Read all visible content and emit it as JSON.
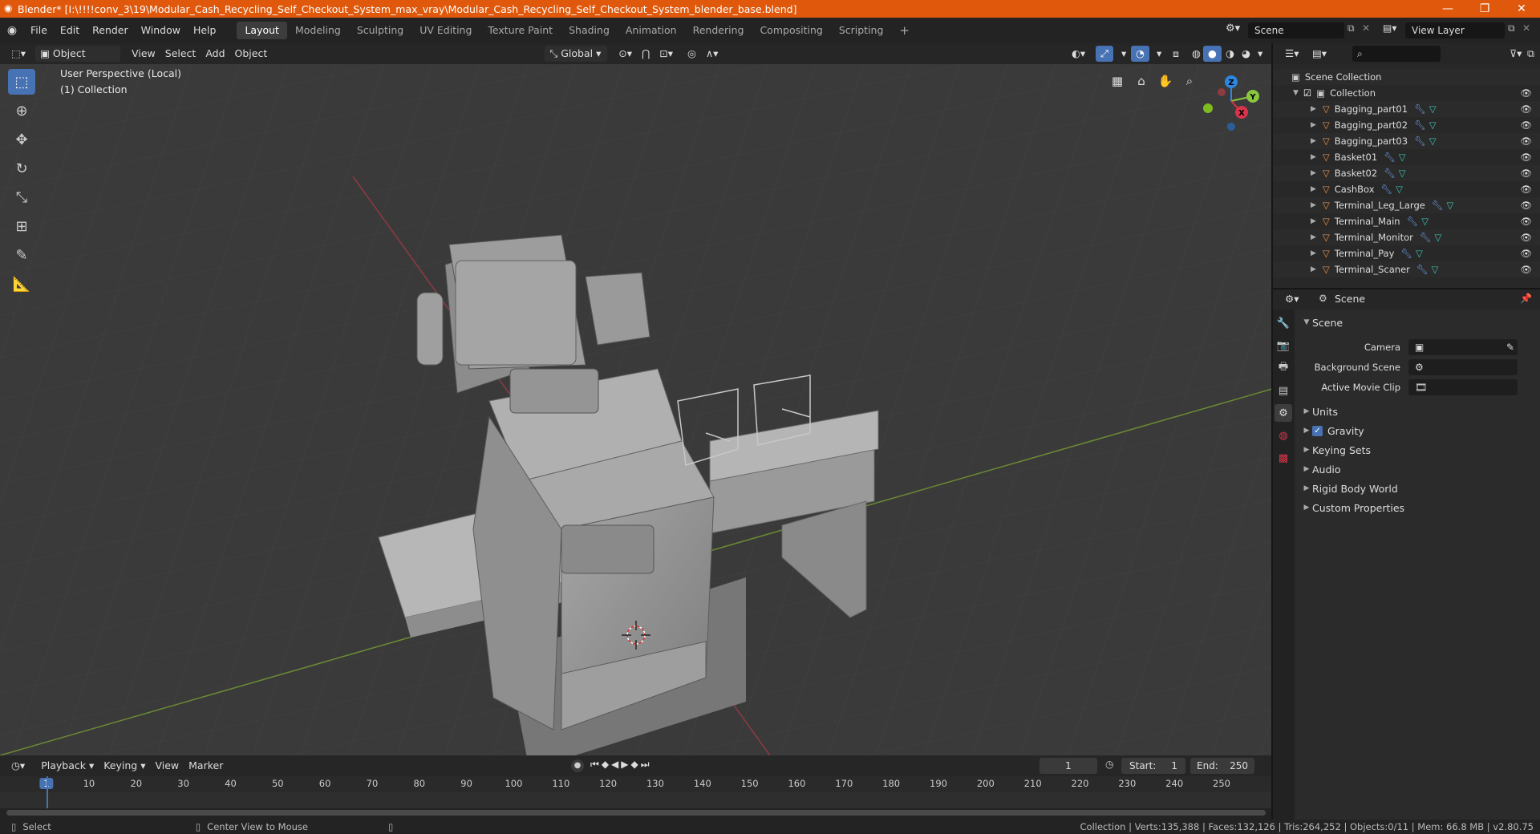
{
  "titlebar": {
    "title": "Blender* [I:\\!!!!conv_3\\19\\Modular_Cash_Recycling_Self_Checkout_System_max_vray\\Modular_Cash_Recycling_Self_Checkout_System_blender_base.blend]",
    "minimize": "—",
    "maximize": "❐",
    "close": "✕",
    "bg_color": "#e0580b"
  },
  "menubar": {
    "items": [
      "File",
      "Edit",
      "Render",
      "Window",
      "Help"
    ]
  },
  "workspaces": {
    "tabs": [
      "Layout",
      "Modeling",
      "Sculpting",
      "UV Editing",
      "Texture Paint",
      "Shading",
      "Animation",
      "Rendering",
      "Compositing",
      "Scripting"
    ],
    "active": "Layout",
    "add": "+"
  },
  "scene_selector": {
    "value": "Scene"
  },
  "view_layer_selector": {
    "value": "View Layer"
  },
  "viewport_header": {
    "mode": "Object Mode",
    "menus": [
      "View",
      "Select",
      "Add",
      "Object"
    ],
    "orientation": "Global"
  },
  "viewport": {
    "perspective_label": "User Perspective (Local)",
    "collection_label": "(1) Collection",
    "gizmo": {
      "z": "Z",
      "y": "Y",
      "x": "X"
    }
  },
  "outliner": {
    "root": "Scene Collection",
    "collection": "Collection",
    "objects": [
      "Bagging_part01",
      "Bagging_part02",
      "Bagging_part03",
      "Basket01",
      "Basket02",
      "CashBox",
      "Terminal_Leg_Large",
      "Terminal_Main",
      "Terminal_Monitor",
      "Terminal_Pay",
      "Terminal_Scaner"
    ]
  },
  "properties": {
    "header": "Scene",
    "section": "Scene",
    "fields": [
      {
        "label": "Camera",
        "value": ""
      },
      {
        "label": "Background Scene",
        "value": ""
      },
      {
        "label": "Active Movie Clip",
        "value": ""
      }
    ],
    "panels": [
      "Units",
      "Gravity",
      "Keying Sets",
      "Audio",
      "Rigid Body World",
      "Custom Properties"
    ],
    "gravity_checked": true
  },
  "timeline": {
    "menus": [
      "Playback",
      "Keying",
      "View",
      "Marker"
    ],
    "current_frame": "1",
    "start_label": "Start:",
    "start": "1",
    "end_label": "End:",
    "end": "250",
    "ruler": [
      "1",
      "10",
      "20",
      "30",
      "40",
      "50",
      "60",
      "70",
      "80",
      "90",
      "100",
      "110",
      "120",
      "130",
      "140",
      "150",
      "160",
      "170",
      "180",
      "190",
      "200",
      "210",
      "220",
      "230",
      "240",
      "250"
    ]
  },
  "statusbar": {
    "select": "Select",
    "center_view": "Center View to Mouse",
    "stats": "Collection | Verts:135,388 | Faces:132,126 | Tris:264,252 | Objects:0/11 | Mem: 66.8 MB | v2.80.75"
  },
  "colors": {
    "accent": "#4772b3",
    "object_icon": "#e8924a",
    "mesh_icon": "#3fc1b4",
    "x_axis": "#d9344a",
    "y_axis": "#8bc63f",
    "z_axis": "#2f86e0"
  }
}
